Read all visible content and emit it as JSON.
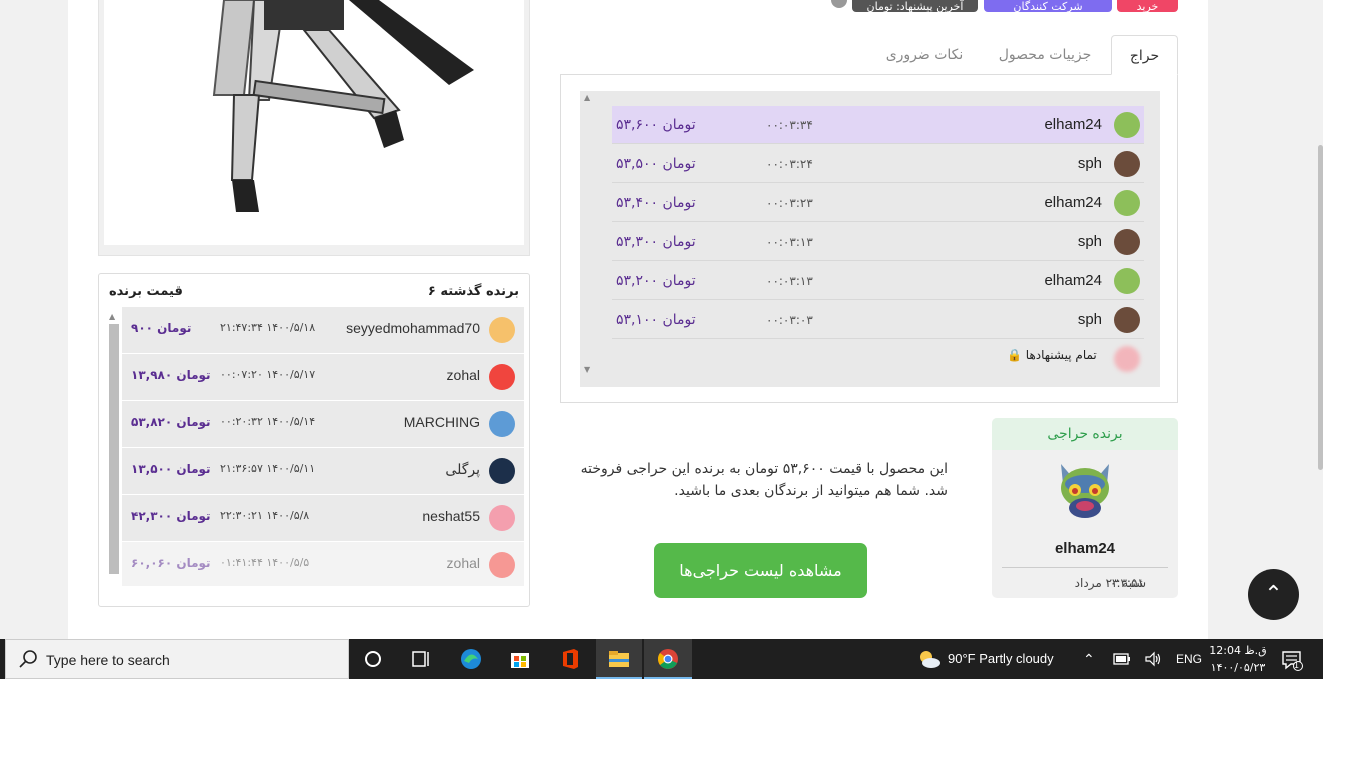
{
  "badges": {
    "red": "خرید",
    "purple": "شرکت کنندگان",
    "dark": "آخرین پیشنهاد: تومان"
  },
  "tabs": [
    {
      "label": "حراج"
    },
    {
      "label": "جزییات محصول"
    },
    {
      "label": "نکات ضروری"
    }
  ],
  "bids": [
    {
      "user": "elham24",
      "time": "۰۰:۰۳:۳۴",
      "price": "۵۳,۶۰۰ تومان"
    },
    {
      "user": "sph",
      "time": "۰۰:۰۳:۲۴",
      "price": "۵۳,۵۰۰ تومان"
    },
    {
      "user": "elham24",
      "time": "۰۰:۰۳:۲۳",
      "price": "۵۳,۴۰۰ تومان"
    },
    {
      "user": "sph",
      "time": "۰۰:۰۳:۱۳",
      "price": "۵۳,۳۰۰ تومان"
    },
    {
      "user": "elham24",
      "time": "۰۰:۰۳:۱۳",
      "price": "۵۳,۲۰۰ تومان"
    },
    {
      "user": "sph",
      "time": "۰۰:۰۳:۰۳",
      "price": "۵۳,۱۰۰ تومان"
    }
  ],
  "all_bids_label": "تمام پیشنهادها",
  "winners": {
    "count_title": "۶ برنده گذشته",
    "price_title": "قیمت برنده",
    "rows": [
      {
        "user": "seyyedmohammad70",
        "date": "۲۱:۴۷:۳۴ ۱۴۰۰/۵/۱۸",
        "price": "۹۰۰ تومان"
      },
      {
        "user": "zohal",
        "date": "۰۰:۰۷:۲۰ ۱۴۰۰/۵/۱۷",
        "price": "۱۳,۹۸۰ تومان"
      },
      {
        "user": "MARCHING",
        "date": "۰۰:۲۰:۳۲ ۱۴۰۰/۵/۱۴",
        "price": "۵۳,۸۲۰ تومان"
      },
      {
        "user": "پرگلی",
        "date": "۲۱:۳۶:۵۷ ۱۴۰۰/۵/۱۱",
        "price": "۱۳,۵۰۰ تومان"
      },
      {
        "user": "neshat55",
        "date": "۲۲:۳۰:۲۱ ۱۴۰۰/۵/۸",
        "price": "۴۲,۳۰۰ تومان"
      },
      {
        "user": "zohal",
        "date": "۰۱:۴۱:۴۴ ۱۴۰۰/۵/۵",
        "price": "۶۰,۰۶۰ تومان"
      }
    ]
  },
  "winner_card": {
    "title": "برنده حراجی",
    "name": "elham24",
    "date": "شنبه ۲۳ مرداد",
    "time": "۰:۳:۵۱"
  },
  "description": "این محصول با قیمت ۵۳,۶۰۰ تومان به برنده این حراجی فروخته شد. شما هم میتوانید از برندگان بعدی ما باشید.",
  "view_list_button": "مشاهده لیست حراجی‌ها",
  "taskbar": {
    "search_placeholder": "Type here to search",
    "weather": "90°F  Partly cloudy",
    "lang": "ENG",
    "clock_time": "12:04 ق.ظ",
    "clock_date": "۱۴۰۰/۰۵/۲۳",
    "notifications": "1"
  },
  "colors": {
    "accent_purple": "#5a2d91",
    "green": "#55b94a",
    "highlight": "#e1d6f5"
  }
}
